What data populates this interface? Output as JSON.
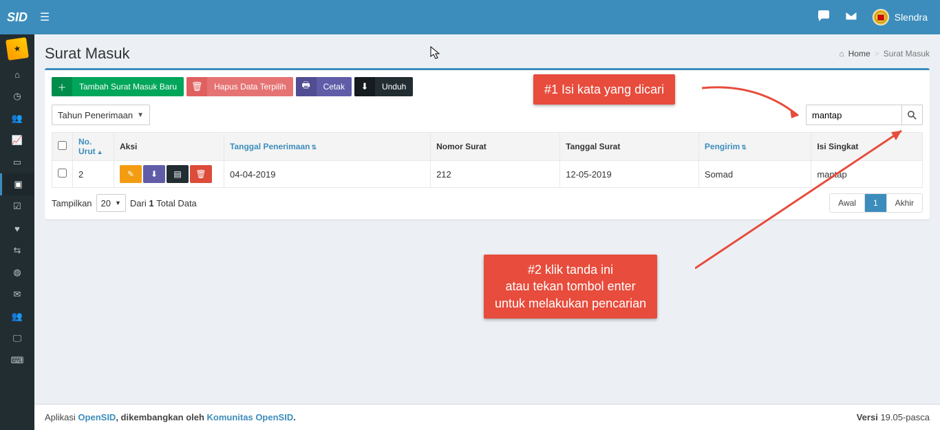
{
  "header": {
    "logo": "SID",
    "user": "Slendra"
  },
  "page": {
    "title": "Surat Masuk",
    "breadcrumb_home": "Home",
    "breadcrumb_current": "Surat Masuk"
  },
  "toolbar": {
    "add": "Tambah Surat Masuk Baru",
    "delete": "Hapus Data Terpilih",
    "print": "Cetak",
    "download": "Unduh"
  },
  "filter": {
    "year_label": "Tahun Penerimaan"
  },
  "search": {
    "value": "mantap"
  },
  "table": {
    "headers": {
      "no": "No. Urut",
      "aksi": "Aksi",
      "tanggal_penerimaan": "Tanggal Penerimaan",
      "nomor_surat": "Nomor Surat",
      "tanggal_surat": "Tanggal Surat",
      "pengirim": "Pengirim",
      "isi_singkat": "Isi Singkat"
    },
    "rows": [
      {
        "no": "2",
        "tanggal_penerimaan": "04-04-2019",
        "nomor_surat": "212",
        "tanggal_surat": "12-05-2019",
        "pengirim": "Somad",
        "isi_singkat": "mantap"
      }
    ],
    "footer": {
      "show_prefix": "Tampilkan",
      "page_size": "20",
      "show_mid": "Dari",
      "total": "1",
      "show_suffix": "Total Data"
    },
    "pagination": {
      "first": "Awal",
      "current": "1",
      "last": "Akhir"
    }
  },
  "callouts": {
    "c1": "#1 Isi kata yang dicari",
    "c2_l1": "#2 klik tanda ini",
    "c2_l2": "atau tekan tombol enter",
    "c2_l3": "untuk melakukan pencarian"
  },
  "footer": {
    "app_prefix": "Aplikasi ",
    "app_link": "OpenSID",
    "app_mid": ", dikembangkan oleh ",
    "community": "Komunitas OpenSID",
    "version_label": "Versi",
    "version": "19.05-pasca"
  }
}
